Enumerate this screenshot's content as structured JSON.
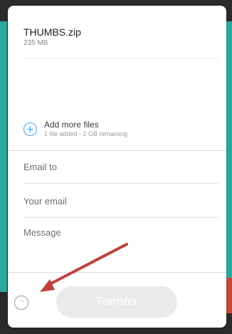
{
  "file": {
    "name": "THUMBS.zip",
    "size": "235 MB"
  },
  "add_files": {
    "title": "Add more files",
    "subtitle": "1 file added - 2 GB remaining",
    "icon": "plus-circle-icon"
  },
  "form": {
    "email_to_placeholder": "Email to",
    "your_email_placeholder": "Your email",
    "message_placeholder": "Message"
  },
  "footer": {
    "more_icon": "ellipsis-icon",
    "more_glyph": "···",
    "transfer_label": "Transfer"
  },
  "colors": {
    "accent_blue": "#409fff",
    "teal_background": "#2aa8a0",
    "red_background": "#c8463a",
    "annotation_arrow": "#c0413c",
    "transfer_disabled": "#e8eaec"
  }
}
